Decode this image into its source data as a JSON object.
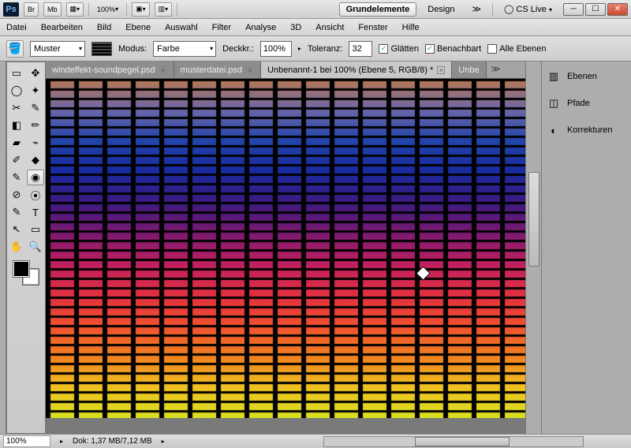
{
  "titlebar": {
    "br": "Br",
    "mb": "Mb",
    "zoom": "100%",
    "workspace_active": "Grundelemente",
    "workspace_design": "Design",
    "cslive": "CS Live"
  },
  "menu": [
    "Datei",
    "Bearbeiten",
    "Bild",
    "Ebene",
    "Auswahl",
    "Filter",
    "Analyse",
    "3D",
    "Ansicht",
    "Fenster",
    "Hilfe"
  ],
  "opt": {
    "fill_label": "Muster",
    "mode_label": "Modus:",
    "mode_value": "Farbe",
    "opacity_label": "Deckkr.:",
    "opacity_value": "100%",
    "tol_label": "Toleranz:",
    "tol_value": "32",
    "smooth": "Glätten",
    "contig": "Benachbart",
    "alllayers": "Alle Ebenen"
  },
  "tabs": [
    {
      "label": "windeffekt-soundpegel.psd",
      "active": false
    },
    {
      "label": "musterdatei.psd",
      "active": false
    },
    {
      "label": "Unbenannt-1 bei 100% (Ebene 5, RGB/8) *",
      "active": true
    },
    {
      "label": "Unbe",
      "active": false,
      "overflow": true
    }
  ],
  "panels": [
    {
      "icon": "▥",
      "label": "Ebenen"
    },
    {
      "icon": "◫",
      "label": "Pfade"
    },
    {
      "icon": "◐",
      "label": "Korrekturen"
    }
  ],
  "tool_icons": [
    "▭",
    "✥",
    "◯",
    "✦",
    "✂",
    "✎",
    "◧",
    "✏",
    "▰",
    "⌁",
    "✐",
    "◆",
    "✎",
    "◉",
    "⊘",
    "⦿",
    "✎",
    "T",
    "↖",
    "▭",
    "✋",
    "🔍"
  ],
  "status": {
    "zoom": "100%",
    "doc": "Dok: 1,37 MB/7,12 MB"
  },
  "canvas_gradient": [
    "#b87850",
    "#6a67a8",
    "#2244aa",
    "#1a2aa0",
    "#3a1a80",
    "#7a1a70",
    "#c02060",
    "#e03040",
    "#f05030",
    "#f08020",
    "#f0c020",
    "#d8e020"
  ]
}
